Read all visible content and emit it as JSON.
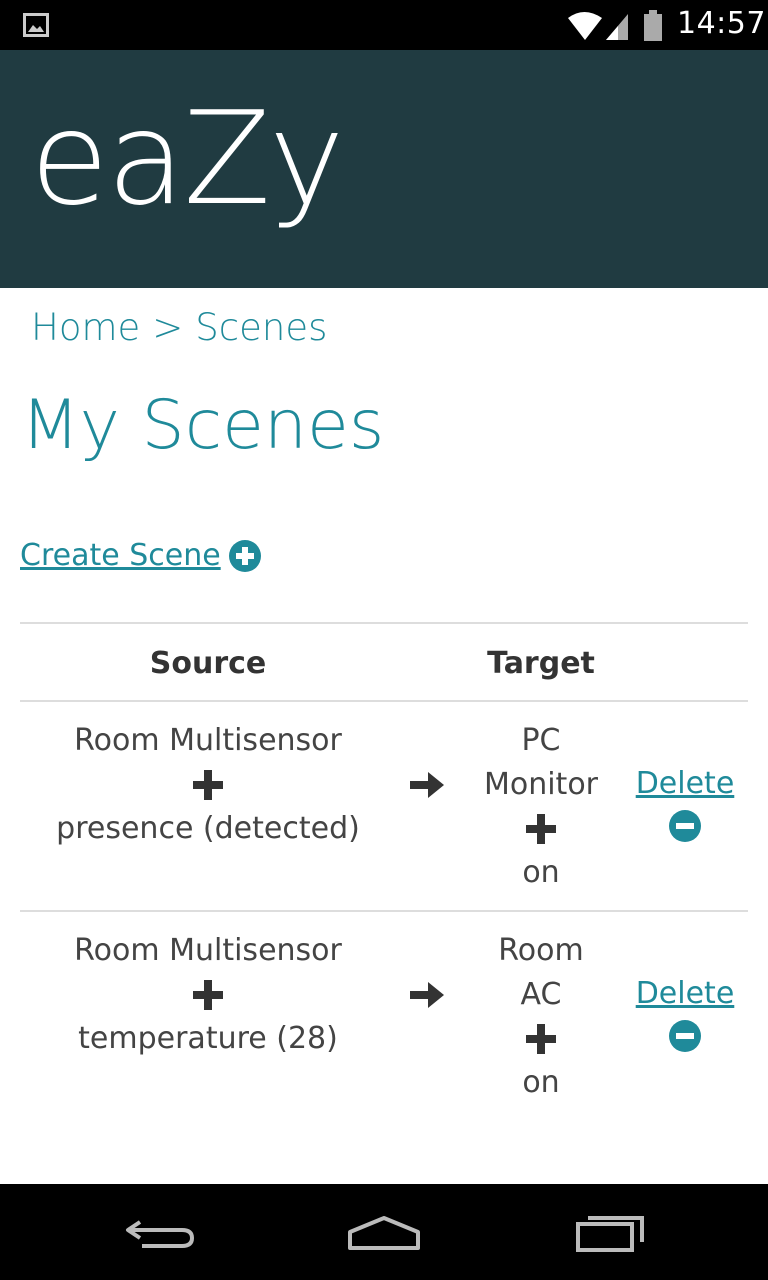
{
  "status_bar": {
    "time": "14:57",
    "icons": [
      "gallery-icon",
      "wifi-icon",
      "cell-signal-icon",
      "battery-icon"
    ]
  },
  "app": {
    "title": "eaZy",
    "header_color": "#203b41",
    "accent_color": "#1f8a9a"
  },
  "breadcrumb": {
    "home": "Home",
    "separator": ">",
    "current": "Scenes"
  },
  "page": {
    "title": "My Scenes",
    "create_label": "Create Scene"
  },
  "table": {
    "headers": {
      "source": "Source",
      "target": "Target"
    },
    "rows": [
      {
        "source_device": "Room Multisensor",
        "source_condition": "presence (detected)",
        "target_device_line1": "PC",
        "target_device_line2": "Monitor",
        "target_action": "on",
        "delete_label": "Delete"
      },
      {
        "source_device": "Room Multisensor",
        "source_condition": "temperature (28)",
        "target_device_line1": "Room",
        "target_device_line2": "AC",
        "target_action": "on",
        "delete_label": "Delete"
      }
    ]
  },
  "nav_bar": {
    "icons": [
      "back-icon",
      "home-icon",
      "recent-apps-icon"
    ]
  }
}
